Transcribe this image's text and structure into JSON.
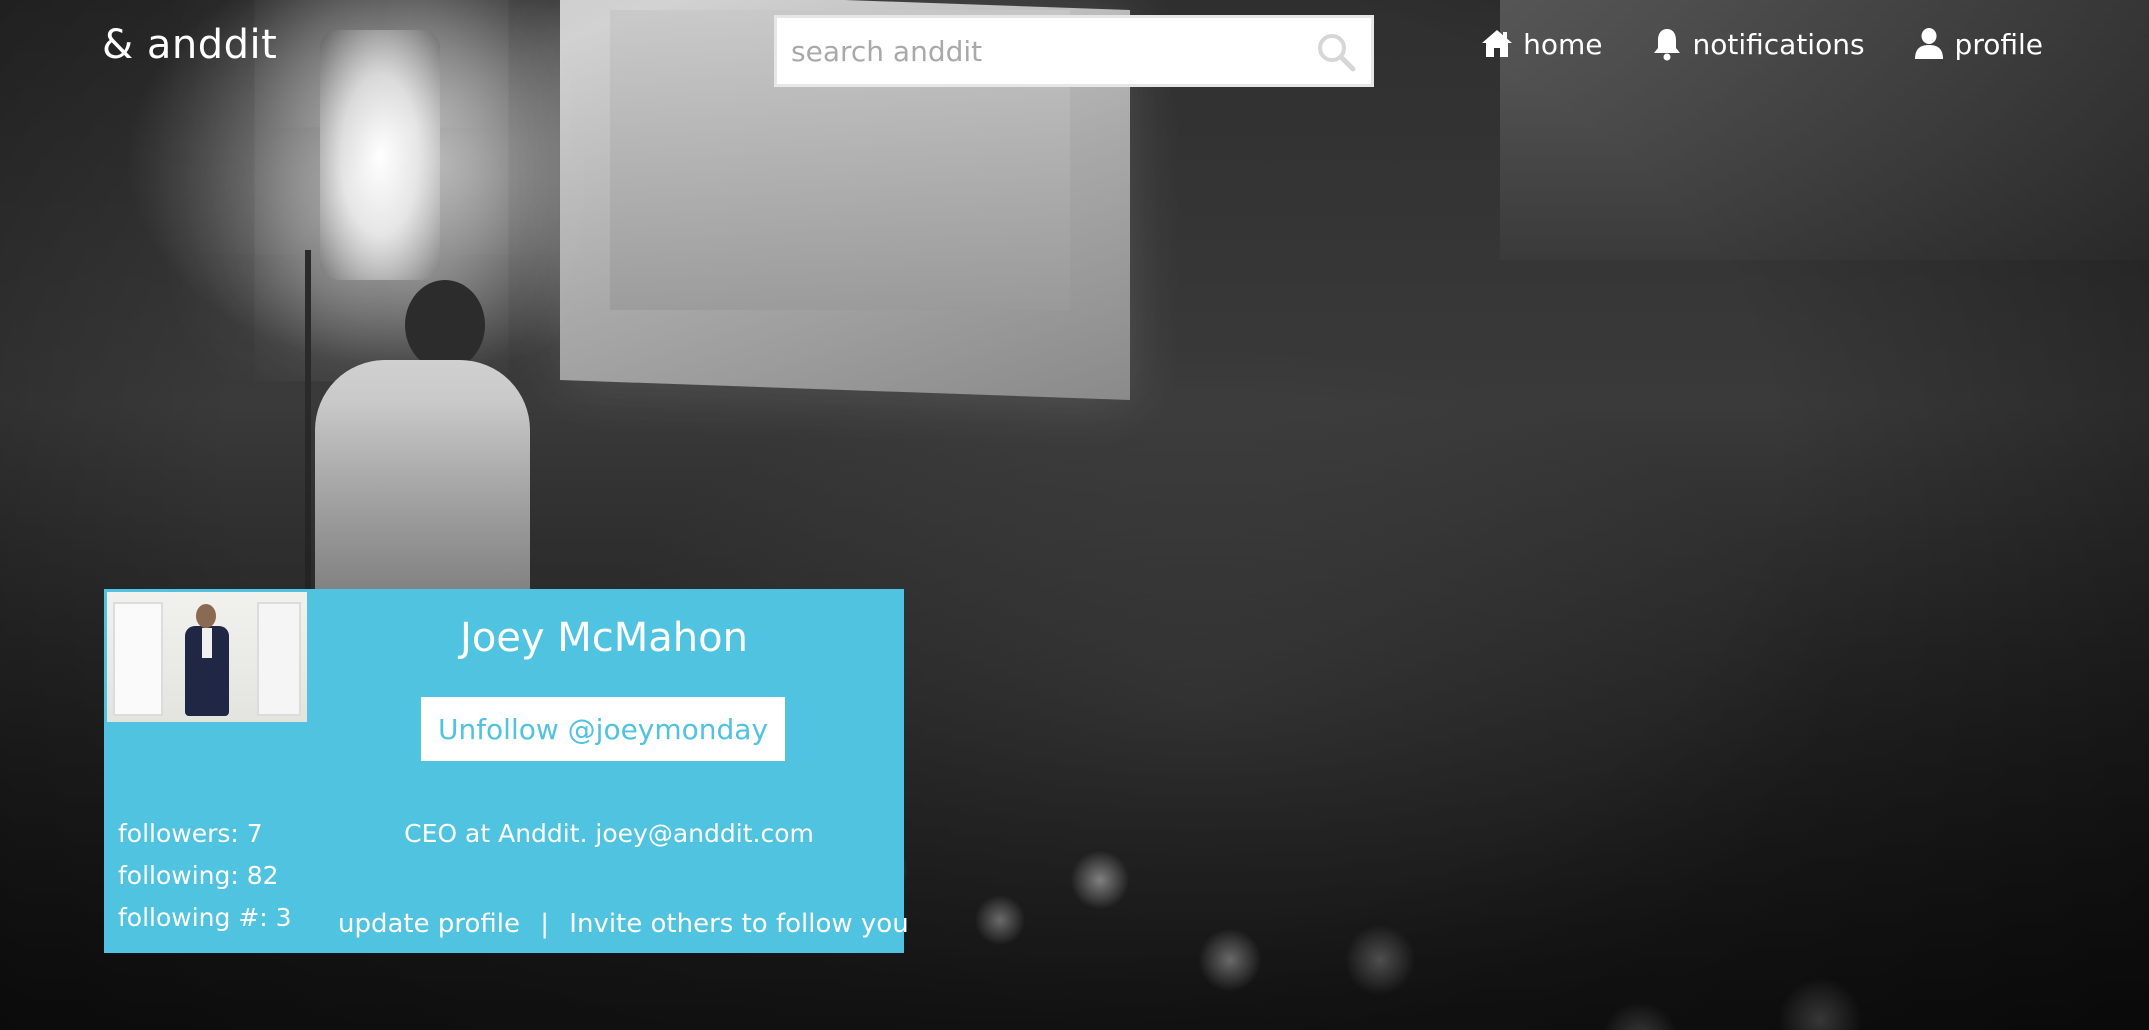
{
  "brand": {
    "name": "& anddit"
  },
  "search": {
    "placeholder": "search anddit",
    "value": "",
    "icon": "search-icon"
  },
  "nav": {
    "items": [
      {
        "label": "home",
        "icon": "home-icon"
      },
      {
        "label": "notifications",
        "icon": "bell-icon"
      },
      {
        "label": "profile",
        "icon": "user-icon"
      }
    ]
  },
  "profile": {
    "name": "Joey McMahon",
    "follow_button": "Unfollow @joeymonday",
    "stats": {
      "followers": "followers: 7",
      "following": "following: 82",
      "following_hashtags": "following #: 3"
    },
    "bio": "CEO at Anddit. joey@anddit.com",
    "actions": {
      "update_profile": "update profile",
      "separator": "|",
      "invite": "Invite others to follow you"
    }
  },
  "colors": {
    "accent": "#4fc3df",
    "nav_text": "#ffffff",
    "search_bg": "#ffffff",
    "placeholder": "#a9a9a9"
  }
}
